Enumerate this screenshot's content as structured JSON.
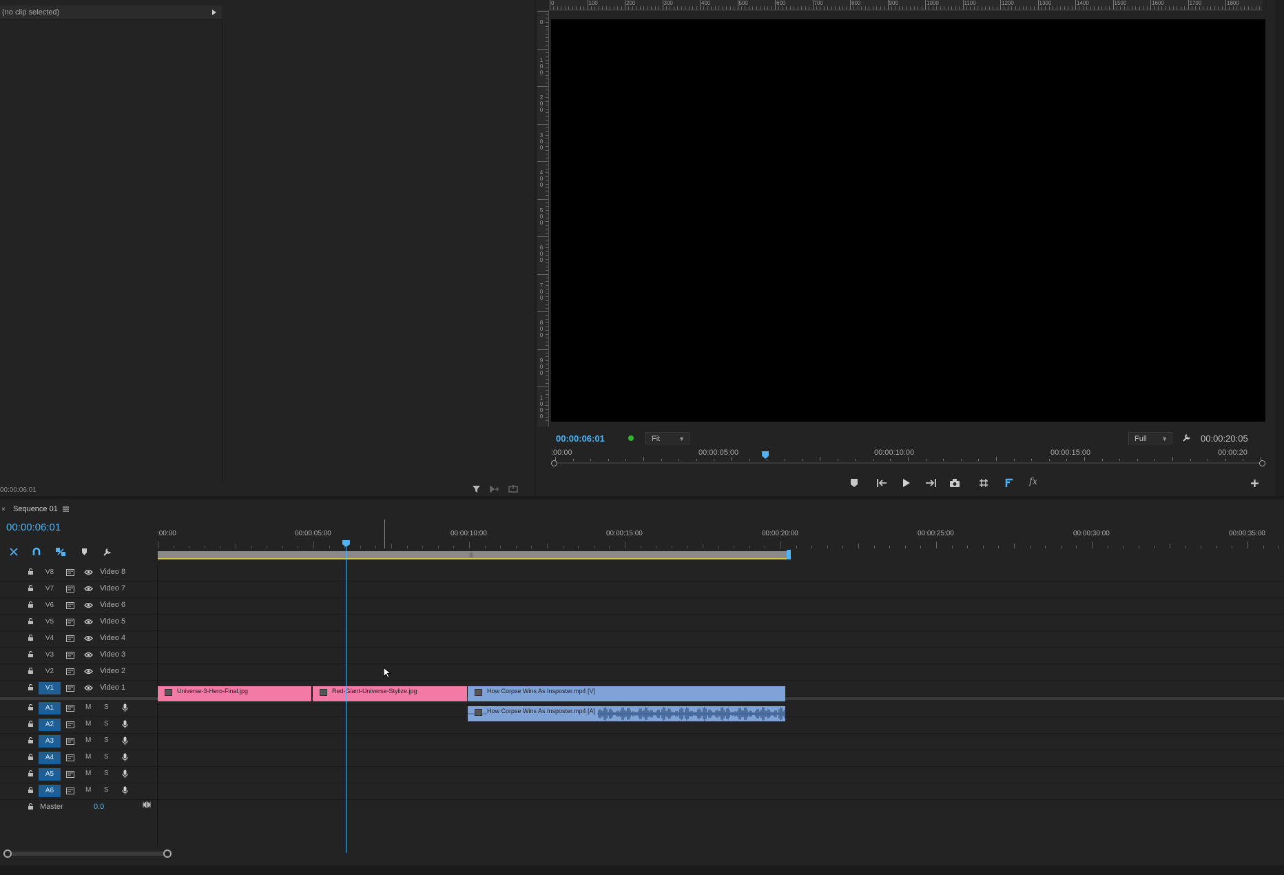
{
  "source_panel": {
    "no_clip_label": "(no clip selected)",
    "timecode": "00:00:06:01"
  },
  "program_monitor": {
    "h_ruler_labels": [
      "0",
      "100",
      "200",
      "300",
      "400",
      "500",
      "600",
      "700",
      "800",
      "900",
      "1000",
      "1100",
      "1200",
      "1300",
      "1400",
      "1500",
      "1600",
      "1700",
      "1800"
    ],
    "v_ruler_labels": [
      "0",
      "100",
      "200",
      "300",
      "400",
      "500",
      "600",
      "700",
      "800",
      "900",
      "1000"
    ],
    "current_timecode": "00:00:06:01",
    "zoom_value": "Fit",
    "resolution_value": "Full",
    "duration_timecode": "00:00:20:05",
    "mini_ruler_labels": [
      ":00:00",
      "00:00:05:00",
      "00:00:10:00",
      "00:00:15:00",
      "00:00:20"
    ],
    "playhead_fraction": 0.3
  },
  "timeline": {
    "tab_title": "Sequence 01",
    "current_timecode": "00:00:06:01",
    "ruler_labels": [
      ":00:00",
      "00:00:05:00",
      "00:00:10:00",
      "00:00:15:00",
      "00:00:20:00",
      "00:00:25:00",
      "00:00:30:00",
      "00:00:35:00"
    ],
    "video_tracks": [
      {
        "id": "V8",
        "name": "Video 8",
        "targeted": false
      },
      {
        "id": "V7",
        "name": "Video 7",
        "targeted": false
      },
      {
        "id": "V6",
        "name": "Video 6",
        "targeted": false
      },
      {
        "id": "V5",
        "name": "Video 5",
        "targeted": false
      },
      {
        "id": "V4",
        "name": "Video 4",
        "targeted": false
      },
      {
        "id": "V3",
        "name": "Video 3",
        "targeted": false
      },
      {
        "id": "V2",
        "name": "Video 2",
        "targeted": false
      },
      {
        "id": "V1",
        "name": "Video 1",
        "targeted": true
      }
    ],
    "audio_tracks": [
      {
        "id": "A1",
        "m": "M",
        "s": "S"
      },
      {
        "id": "A2",
        "m": "M",
        "s": "S"
      },
      {
        "id": "A3",
        "m": "M",
        "s": "S"
      },
      {
        "id": "A4",
        "m": "M",
        "s": "S"
      },
      {
        "id": "A5",
        "m": "M",
        "s": "S"
      },
      {
        "id": "A6",
        "m": "M",
        "s": "S"
      }
    ],
    "master": {
      "label": "Master",
      "value": "0.0"
    },
    "clips": {
      "clip1": "Universe-3-Hero-Final.jpg",
      "clip2": "Red-Giant-Universe-Stylize.jpg",
      "clip3": "How Corpse Wins As Insposter.mp4 [V]",
      "clip4": "How Corpse Wins As Insposter.mp4 [A]"
    },
    "colors": {
      "image_clip": "#f27aa4",
      "video_clip": "#7fa3d6",
      "audio_clip": "#7fa3d6",
      "playhead": "#4fb3f5",
      "target_track": "#1f5f96"
    }
  }
}
